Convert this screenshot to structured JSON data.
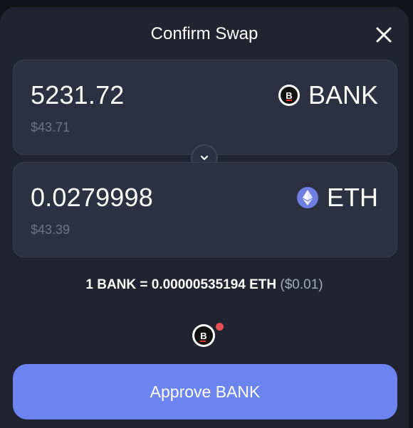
{
  "modal": {
    "title": "Confirm Swap"
  },
  "from": {
    "amount": "5231.72",
    "usd": "$43.71",
    "token": "BANK",
    "logo_letter": "B"
  },
  "to": {
    "amount": "0.0279998",
    "usd": "$43.39",
    "token": "ETH"
  },
  "rate": {
    "text": "1 BANK = 0.00000535194 ETH",
    "usd": "($0.01)"
  },
  "footer_logo_letter": "B",
  "approve_label": "Approve BANK",
  "colors": {
    "background": "#212430",
    "card": "#2c3040",
    "accent": "#6b84ef",
    "notification_dot": "#e34f4f",
    "muted_text": "#707585"
  }
}
